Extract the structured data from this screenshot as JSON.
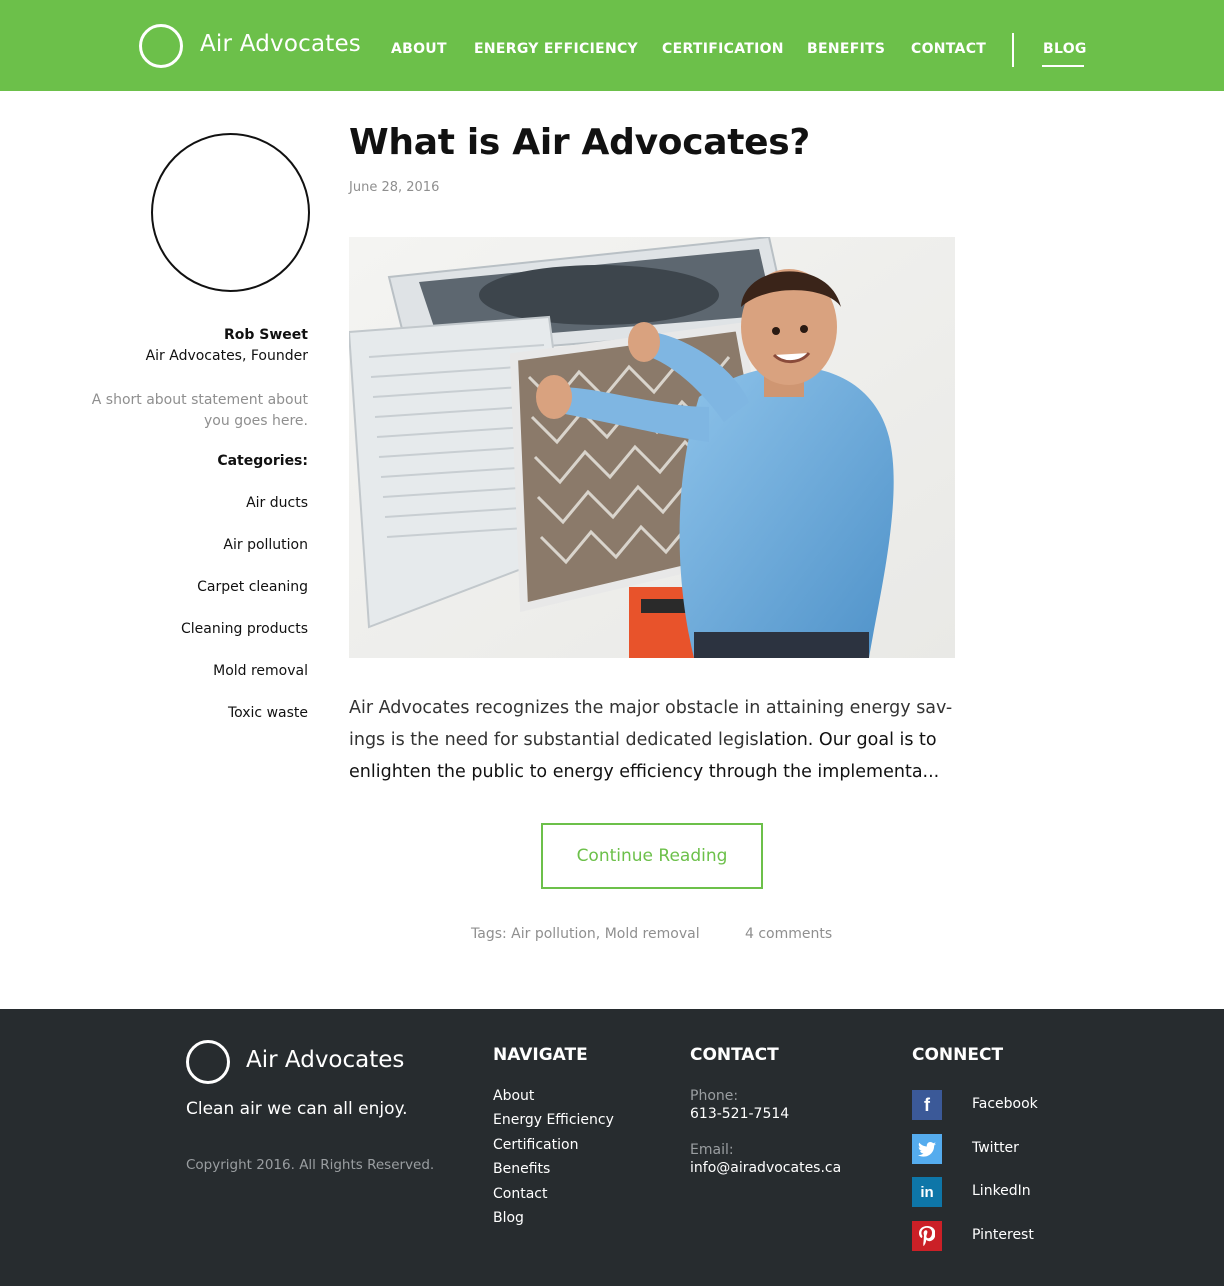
{
  "brand": {
    "name": "Air Advocates"
  },
  "nav": {
    "items": [
      "ABOUT",
      "ENERGY EFFICIENCY",
      "CERTIFICATION",
      "BENEFITS",
      "CONTACT"
    ],
    "blog": "BLOG"
  },
  "author": {
    "name": "Rob Sweet",
    "role": "Air Advocates, Founder",
    "about_line1": "A short about statement about",
    "about_line2": "you goes here."
  },
  "categories": {
    "heading": "Categories:",
    "items": [
      "Air ducts",
      "Air pollution",
      "Carpet cleaning",
      "Cleaning products",
      "Mold removal",
      "Toxic waste"
    ]
  },
  "post": {
    "title": "What is Air Advocates?",
    "date": "June 28, 2016",
    "excerpt_line1": "Air Advocates recognizes the major obstacle in attaining energy sav-",
    "excerpt_line2a": "ings is the need for substantial dedicated legis",
    "excerpt_line2b": "lation. Our goal is to",
    "excerpt_line3": "enlighten the public to energy efficiency through the implementa...",
    "continue_label": "Continue Reading",
    "tags_label": "Tags:",
    "tag1": "Air pollution",
    "tag2": "Mold removal",
    "comments": "4 comments"
  },
  "footer": {
    "brand": "Air Advocates",
    "tagline": "Clean air we can all enjoy.",
    "copyright": "Copyright 2016. All Rights Reserved.",
    "navigate_heading": "NAVIGATE",
    "navigate_links": [
      "About",
      "Energy Efficiency",
      "Certification",
      "Benefits",
      "Contact",
      "Blog"
    ],
    "contact_heading": "CONTACT",
    "phone_label": "Phone:",
    "phone": "613-521-7514",
    "email_label": "Email:",
    "email": "info@airadvocates.ca",
    "connect_heading": "CONNECT",
    "social": [
      {
        "label": "Facebook",
        "glyph": "f",
        "color": "#3b5998",
        "icon": "facebook-icon"
      },
      {
        "label": "Twitter",
        "glyph": "t",
        "color": "#55acee",
        "icon": "twitter-icon"
      },
      {
        "label": "LinkedIn",
        "glyph": "in",
        "color": "#0e76a8",
        "icon": "linkedin-icon"
      },
      {
        "label": "Pinterest",
        "glyph": "p",
        "color": "#cb2027",
        "icon": "pinterest-icon"
      }
    ]
  },
  "colors": {
    "brand_green": "#6cc04a",
    "footer_bg": "#272c2f"
  }
}
